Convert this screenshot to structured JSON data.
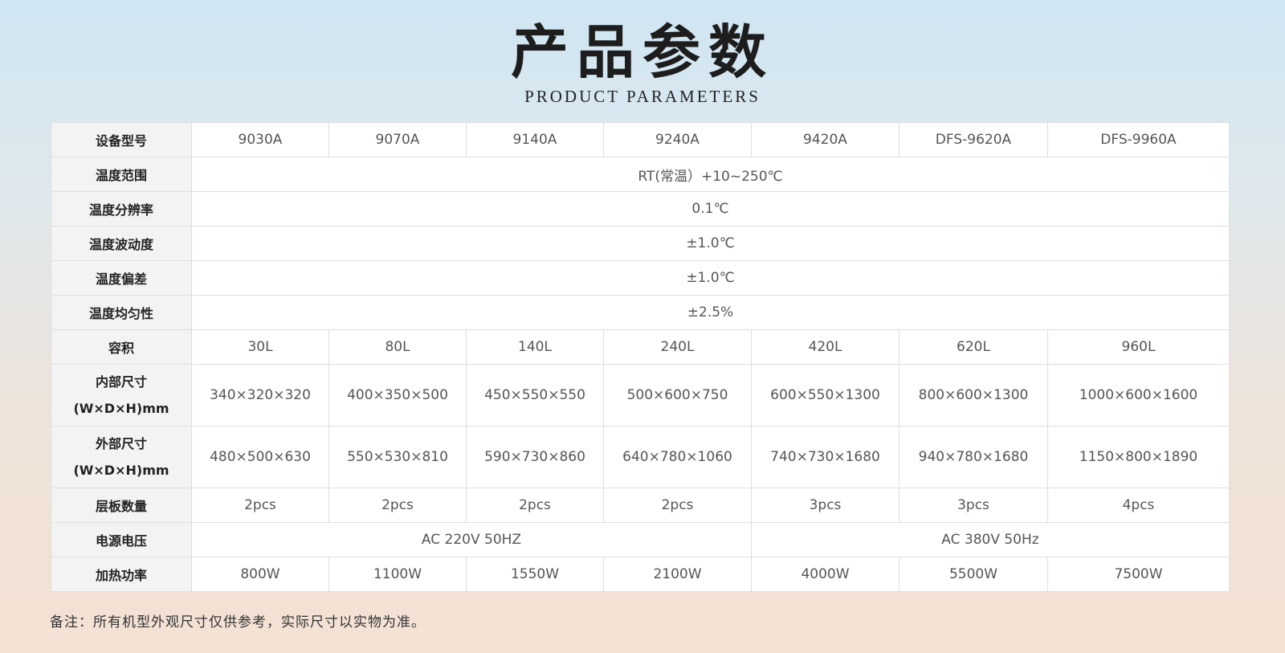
{
  "header": {
    "title": "产品参数",
    "subtitle": "PRODUCT PARAMETERS"
  },
  "table": {
    "model_label": "设备型号",
    "models": [
      "9030A",
      "9070A",
      "9140A",
      "9240A",
      "9420A",
      "DFS-9620A",
      "DFS-9960A"
    ],
    "temp_range_label": "温度范围",
    "temp_range": "RT(常温）+10~250℃",
    "temp_resolution_label": "温度分辨率",
    "temp_resolution": "0.1℃",
    "temp_fluctuation_label": "温度波动度",
    "temp_fluctuation": "±1.0℃",
    "temp_deviation_label": "温度偏差",
    "temp_deviation": "±1.0℃",
    "temp_uniformity_label": "温度均匀性",
    "temp_uniformity": "±2.5%",
    "volume_label": "容积",
    "volumes": [
      "30L",
      "80L",
      "140L",
      "240L",
      "420L",
      "620L",
      "960L"
    ],
    "inner_size_label_1": "内部尺寸",
    "inner_size_label_2": "(W×D×H)mm",
    "inner_sizes": [
      "340×320×320",
      "400×350×500",
      "450×550×550",
      "500×600×750",
      "600×550×1300",
      "800×600×1300",
      "1000×600×1600"
    ],
    "outer_size_label_1": "外部尺寸",
    "outer_size_label_2": "(W×D×H)mm",
    "outer_sizes": [
      "480×500×630",
      "550×530×810",
      "590×730×860",
      "640×780×1060",
      "740×730×1680",
      "940×780×1680",
      "1150×800×1890"
    ],
    "shelves_label": "层板数量",
    "shelves": [
      "2pcs",
      "2pcs",
      "2pcs",
      "2pcs",
      "3pcs",
      "3pcs",
      "4pcs"
    ],
    "power_supply_label": "电源电压",
    "power_supply": [
      "AC 220V 50HZ",
      "AC 380V 50Hz"
    ],
    "heating_power_label": "加热功率",
    "heating_power": [
      "800W",
      "1100W",
      "1550W",
      "2100W",
      "4000W",
      "5500W",
      "7500W"
    ]
  },
  "note": "备注：所有机型外观尺寸仅供参考，实际尺寸以实物为准。"
}
